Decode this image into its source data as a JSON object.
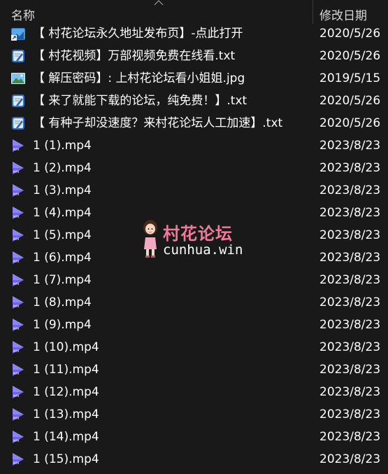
{
  "header": {
    "name_column": "名称",
    "date_column": "修改日期"
  },
  "files": [
    {
      "name": "【 村花论坛永久地址发布页】-点此打开",
      "date": "2020/5/26",
      "icon": "url-shortcut-icon"
    },
    {
      "name": "【 村花视频】万部视频免费在线看.txt",
      "date": "2020/5/26",
      "icon": "text-file-icon"
    },
    {
      "name": "【 解压密码】: 上村花论坛看小姐姐.jpg",
      "date": "2019/5/15",
      "icon": "image-file-icon"
    },
    {
      "name": "【 来了就能下载的论坛，纯免费！】.txt",
      "date": "2020/5/26",
      "icon": "text-file-icon"
    },
    {
      "name": "【 有种子却没速度？来村花论坛人工加速】.txt",
      "date": "2020/5/26",
      "icon": "text-file-icon"
    },
    {
      "name": "1 (1).mp4",
      "date": "2023/8/23",
      "icon": "video-file-icon"
    },
    {
      "name": "1 (2).mp4",
      "date": "2023/8/23",
      "icon": "video-file-icon"
    },
    {
      "name": "1 (3).mp4",
      "date": "2023/8/23",
      "icon": "video-file-icon"
    },
    {
      "name": "1 (4).mp4",
      "date": "2023/8/23",
      "icon": "video-file-icon"
    },
    {
      "name": "1 (5).mp4",
      "date": "2023/8/23",
      "icon": "video-file-icon"
    },
    {
      "name": "1 (6).mp4",
      "date": "2023/8/23",
      "icon": "video-file-icon"
    },
    {
      "name": "1 (7).mp4",
      "date": "2023/8/23",
      "icon": "video-file-icon"
    },
    {
      "name": "1 (8).mp4",
      "date": "2023/8/23",
      "icon": "video-file-icon"
    },
    {
      "name": "1 (9).mp4",
      "date": "2023/8/23",
      "icon": "video-file-icon"
    },
    {
      "name": "1 (10).mp4",
      "date": "2023/8/23",
      "icon": "video-file-icon"
    },
    {
      "name": "1 (11).mp4",
      "date": "2023/8/23",
      "icon": "video-file-icon"
    },
    {
      "name": "1 (12).mp4",
      "date": "2023/8/23",
      "icon": "video-file-icon"
    },
    {
      "name": "1 (13).mp4",
      "date": "2023/8/23",
      "icon": "video-file-icon"
    },
    {
      "name": "1 (14).mp4",
      "date": "2023/8/23",
      "icon": "video-file-icon"
    },
    {
      "name": "1 (15).mp4",
      "date": "2023/8/23",
      "icon": "video-file-icon"
    }
  ],
  "watermark": {
    "title": "村花论坛",
    "domain": "cunhua.win"
  },
  "colors": {
    "background": "#191919",
    "text": "#ffffff",
    "watermark_accent": "#f07a9c",
    "video_icon": "#6c63e8"
  }
}
